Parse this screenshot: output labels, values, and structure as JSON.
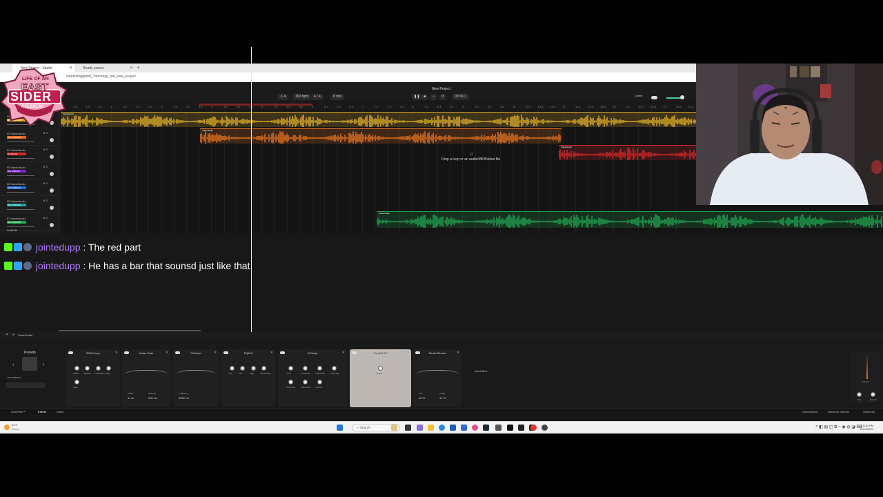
{
  "browser": {
    "tabs": [
      {
        "label": "New Project - Studio",
        "active": true
      },
      {
        "label": "Ready ysever",
        "active": false
      }
    ],
    "new_tab_glyph": "+",
    "url": "/studio/triggered_?mm=app_bar_new_project"
  },
  "logo": {
    "line1": "LIFE OF AN",
    "line2": "EAST",
    "line3": "SIDER",
    "line4": "ROLEPLAY"
  },
  "transport": {
    "project_title": "New Project",
    "bpm": "100 bpm",
    "time_sig": "4 / 4",
    "bars": "8 min",
    "time": "00:09.1",
    "clarity_label": "Clarity"
  },
  "ruler_ticks": [
    "1.2",
    "1.3",
    "1.4",
    "2",
    "2.2",
    "2.3",
    "2.4",
    "3",
    "3.2",
    "3.3",
    "3.4",
    "4",
    "4.2",
    "4.3",
    "4.4",
    "5",
    "5.2",
    "5.3",
    "5.4",
    "6",
    "6.2",
    "6.3",
    "6.4",
    "7",
    "7.2",
    "7.3",
    "7.4",
    "8",
    "8.2",
    "8.3",
    "8.4",
    "9",
    "9.2",
    "9.3",
    "9.4",
    "10",
    "10.2",
    "10.3",
    "10.4",
    "11",
    "11.2",
    "11.3",
    "11.4",
    "12",
    "12.2",
    "12.3",
    "12.4",
    "13",
    "13.2",
    "13.3"
  ],
  "tracks": [
    {
      "name": "02 Voice/Audio",
      "preset": "BASS PRESET",
      "color": "#e0a81a"
    },
    {
      "name": "03 Voice/Audio",
      "preset": "JAYS PRESET",
      "color": "#e0651a"
    },
    {
      "name": "04 Voice/Audio",
      "preset": "SO MUCH",
      "color": "#d6262a"
    },
    {
      "name": "05 Voice/Audio",
      "preset": "BIG PRESET",
      "color": "#7a25c9"
    },
    {
      "name": "06 Voice/Audio",
      "preset": "JAYS PRESET",
      "color": "#1f6fd6"
    },
    {
      "name": "06 Voice/Audio",
      "preset": "JAYS PRESET",
      "color": "#18a5a0"
    },
    {
      "name": "07 Voice/Audio",
      "preset": "JAYS PRESET",
      "color": "#22a64a"
    }
  ],
  "add_track_label": "Add/Edit",
  "clips": [
    {
      "label": "Voice/Audio",
      "color": "#e2b028"
    },
    {
      "label": "Voice/Audio",
      "color": "#e8741f"
    },
    {
      "label": "Voice/Audio",
      "color": "#d6262a"
    },
    {
      "label": "Voice/Audio",
      "color": "#1fa552"
    }
  ],
  "drop_hint": "Drop a loop or an audio/MIDI/video file",
  "chat": [
    {
      "user": "jointedupp",
      "message": ": The red part"
    },
    {
      "user": "jointedupp",
      "message": ": He has a bar that sounsd just like that"
    }
  ],
  "effects_panel": {
    "track_label": "Voice/Audio",
    "presets_label": "Presets",
    "preset_name": "JAYS PRESET",
    "modules": [
      {
        "title": "BX3 Comp",
        "knobs": [
          "Attack",
          "Release",
          "Threshold",
          "Ratio",
          "Knee"
        ]
      },
      {
        "title": "Noise Gate",
        "readouts": [
          "6 ms",
          "200 ms"
        ],
        "readout_labels": [
          "Attack",
          "Release"
        ]
      },
      {
        "title": "DeEsser",
        "readouts": [
          "6392 Hz"
        ],
        "readout_labels": [
          "Frequency"
        ]
      },
      {
        "title": "EQ3-M",
        "knobs": [
          "Low",
          "Mid",
          "High",
          "Mid Sweep"
        ]
      },
      {
        "title": "D-Delay",
        "knobs": [
          "Time",
          "Feedback",
          "High Pass",
          "Low Pass",
          "Dry Level",
          "Wet Level",
          "Volume"
        ]
      },
      {
        "title": "FreqFilt 3.5",
        "knobs": [
          "Linear"
        ]
      },
      {
        "title": "Studio Reverb",
        "readouts": [
          "26 %",
          "17 %"
        ],
        "readout_labels": [
          "Size",
          "Decay"
        ]
      }
    ],
    "add_effect_label": "Add Effect",
    "mixer_labels": [
      "Volume",
      "Pan",
      "Reverb"
    ]
  },
  "statusbar": {
    "autopitch": "AutoPitch™",
    "effects": "Effects",
    "editor": "Editor",
    "right": [
      "Lyrics/Notes",
      "BandLab Sounds",
      "Shortcuts"
    ]
  },
  "taskbar": {
    "weather_temp": "84°F",
    "weather_desc": "Sunny",
    "search_placeholder": "Search",
    "time": "8:30 PM",
    "date": "10/24/2024"
  }
}
